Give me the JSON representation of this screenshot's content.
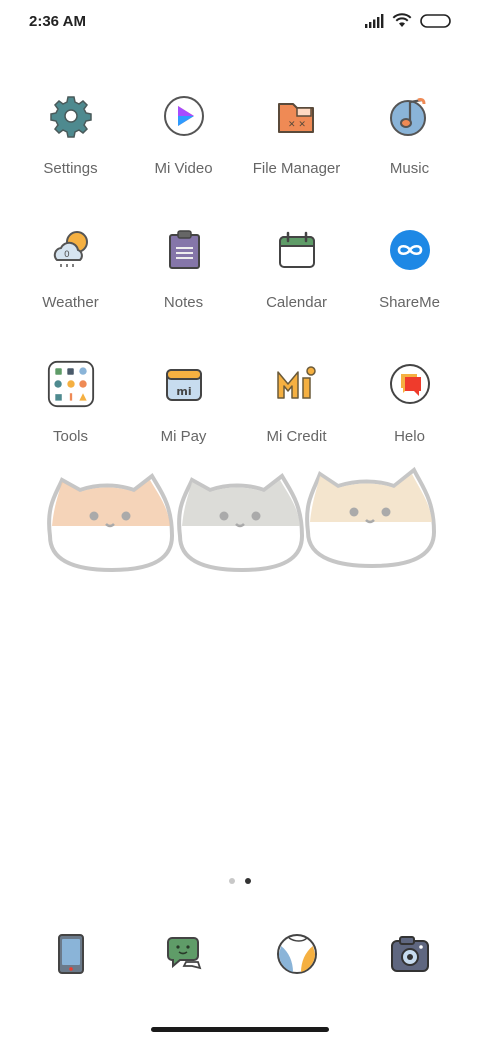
{
  "status_bar": {
    "time": "2:36 AM",
    "icons": [
      "signal-icon",
      "wifi-icon",
      "battery-icon"
    ]
  },
  "apps": [
    {
      "label": "Settings",
      "icon": "gear-icon"
    },
    {
      "label": "Mi Video",
      "icon": "play-icon"
    },
    {
      "label": "File Manager",
      "icon": "folder-icon"
    },
    {
      "label": "Music",
      "icon": "music-note-icon"
    },
    {
      "label": "Weather",
      "icon": "weather-cloud-sun-icon"
    },
    {
      "label": "Notes",
      "icon": "notepad-icon"
    },
    {
      "label": "Calendar",
      "icon": "calendar-icon"
    },
    {
      "label": "ShareMe",
      "icon": "infinity-icon"
    },
    {
      "label": "Tools",
      "icon": "tools-folder-icon"
    },
    {
      "label": "Mi Pay",
      "icon": "wallet-icon"
    },
    {
      "label": "Mi Credit",
      "icon": "mi-credit-icon"
    },
    {
      "label": "Helo",
      "icon": "helo-icon"
    }
  ],
  "page_indicator": {
    "pages": 2,
    "current": 2
  },
  "dock": [
    {
      "icon": "phone-tablet-icon"
    },
    {
      "icon": "chat-bubble-icon"
    },
    {
      "icon": "beach-ball-icon"
    },
    {
      "icon": "camera-icon"
    }
  ],
  "colors": {
    "label": "#666666",
    "settings": "#4e8a8f",
    "folder": "#ef8a55",
    "music": "#8ab4d8",
    "notes": "#8576a9",
    "calendar_top": "#5f9c68",
    "shareme": "#1e88e5",
    "helo": "#ef3b2c"
  }
}
